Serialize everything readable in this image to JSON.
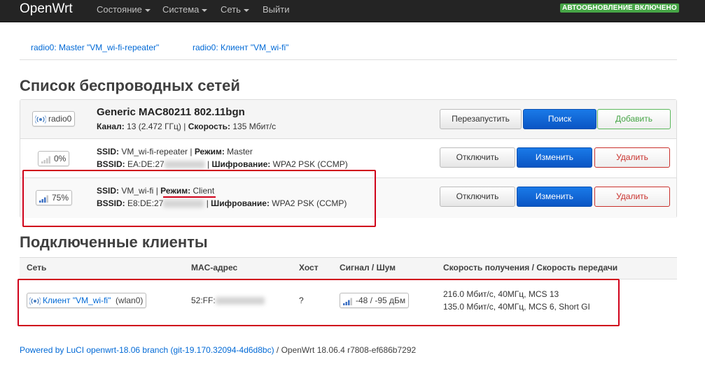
{
  "nav": {
    "brand": "OpenWrt",
    "items": [
      {
        "label": "Состояние",
        "dropdown": true
      },
      {
        "label": "Система",
        "dropdown": true
      },
      {
        "label": "Сеть",
        "dropdown": true
      },
      {
        "label": "Выйти",
        "dropdown": false
      }
    ],
    "badge": "АВТООБНОВЛЕНИЕ ВКЛЮЧЕНО"
  },
  "tabs": [
    "radio0: Master \"VM_wi-fi-repeater\"",
    "radio0: Клиент \"VM_wi-fi\""
  ],
  "wireless": {
    "heading": "Список беспроводных сетей",
    "radio": {
      "badge": "radio0",
      "name": "Generic MAC80211 802.11bgn",
      "channel_label": "Канал:",
      "channel_value": " 13 (2.472 ГГц)",
      "speed_label": "Скорость:",
      "speed_value": " 135 Мбит/с",
      "buttons": {
        "restart": "Перезапустить",
        "scan": "Поиск",
        "add": "Добавить"
      }
    },
    "networks": [
      {
        "signal": "0%",
        "signal_level": 0,
        "ssid_label": "SSID:",
        "ssid": " VM_wi-fi-repeater",
        "mode_label": "Режим:",
        "mode": " Master",
        "bssid_label": "BSSID:",
        "bssid": " EA:DE:27",
        "enc_label": "Шифрование:",
        "enc": " WPA2 PSK (CCMP)",
        "buttons": {
          "disable": "Отключить",
          "edit": "Изменить",
          "remove": "Удалить"
        }
      },
      {
        "signal": "75%",
        "signal_level": 0.75,
        "ssid_label": "SSID:",
        "ssid": " VM_wi-fi",
        "mode_label": "Режим:",
        "mode": " Client",
        "bssid_label": "BSSID:",
        "bssid": " E8:DE:27",
        "enc_label": "Шифрование:",
        "enc": " WPA2 PSK (CCMP)",
        "buttons": {
          "disable": "Отключить",
          "edit": "Изменить",
          "remove": "Удалить"
        }
      }
    ]
  },
  "clients": {
    "heading": "Подключенные клиенты",
    "columns": [
      "Сеть",
      "MAC-адрес",
      "Хост",
      "Сигнал / Шум",
      "Скорость получения / Скорость передачи"
    ],
    "rows": [
      {
        "network_link": "Клиент \"VM_wi-fi\"",
        "iface": "(wlan0)",
        "mac": "52:FF:",
        "host": "?",
        "signal": "-48 / -95 дБм",
        "rx": "216.0 Мбит/с, 40МГц, MCS 13",
        "tx": "135.0 Мбит/с, 40МГц, MCS 6, Short GI"
      }
    ]
  },
  "footer": {
    "link": "Powered by LuCI openwrt-18.06 branch (git-19.170.32094-4d6d8bc)",
    "rest": " / OpenWrt 18.06.4 r7808-ef686b7292"
  },
  "colors": {
    "navbar": "#242424",
    "accent": "#0069d6",
    "primary_button": "#0a63d6",
    "badge_green": "#46a546",
    "danger": "#c9302c",
    "highlight_box": "#d0021b"
  }
}
